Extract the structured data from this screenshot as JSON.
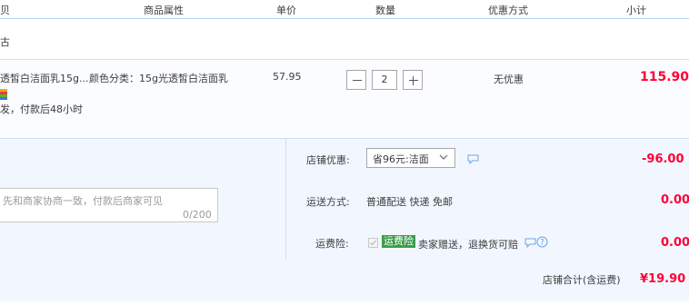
{
  "header": {
    "col_item": "贝",
    "col_attr": "商品属性",
    "col_price": "单价",
    "col_qty": "数量",
    "col_promo": "优惠方式",
    "col_subtotal": "小计"
  },
  "shop": {
    "name": "古"
  },
  "item": {
    "title": "透皙白洁面乳15g...",
    "attr": "颜色分类：15g光透皙白洁面乳",
    "price": "57.95",
    "quantity": "2",
    "promo": "无优惠",
    "subtotal": "115.90",
    "service_note": "发，付款后48小时"
  },
  "message": {
    "placeholder": "先和商家协商一致，付款后商家可见",
    "counter": "0/200"
  },
  "shop_discount": {
    "label": "店铺优惠:",
    "selected": "省96元:洁面",
    "amount": "-96.00"
  },
  "shipping": {
    "label": "运送方式:",
    "method": "普通配送 快递 免邮",
    "amount": "0.00"
  },
  "freight_insurance": {
    "label": "运费险:",
    "badge": "运费险",
    "desc": "卖家赠送，退换货可赔",
    "amount": "0.00"
  },
  "total": {
    "label": "店铺合计(含运费)",
    "amount": "¥19.90"
  },
  "colors": {
    "accent_red": "#ff0036",
    "panel_bg": "#f2f7ff",
    "badge_green": "#3b9d4a",
    "icon_blue": "#6aa7e5"
  },
  "icons": {
    "minus": "minus-icon",
    "plus": "plus-icon",
    "chevron": "chevron-down-icon",
    "comment": "comment-icon",
    "help": "help-circle-icon",
    "promo_tag": "multicolor-tag-icon"
  }
}
